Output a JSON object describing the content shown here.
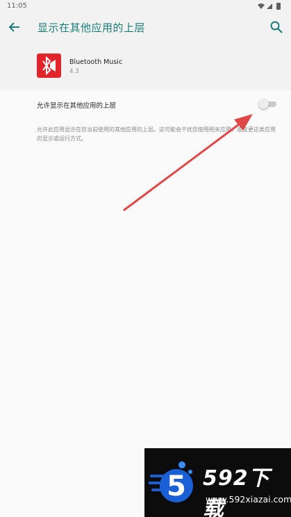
{
  "status_bar": {
    "time": "11:05"
  },
  "app_bar": {
    "title": "显示在其他应用的上层"
  },
  "app": {
    "name": "Bluetooth Music",
    "version": "4.3",
    "icon": "bluetooth-speaker-icon",
    "icon_color": "#e1252a"
  },
  "setting": {
    "label": "允许显示在其他应用的上层",
    "enabled": false,
    "description": "允许此应用显示在您当前使用的其他应用的上层。这可能会干扰您使用相关应用，或变更这类应用的显示或运行方式。"
  },
  "colors": {
    "accent": "#1a7d77",
    "arrow": "#e04848"
  },
  "watermark": {
    "logo_text": "5",
    "brand": "592下载",
    "url": "www.592xiazai.com"
  }
}
